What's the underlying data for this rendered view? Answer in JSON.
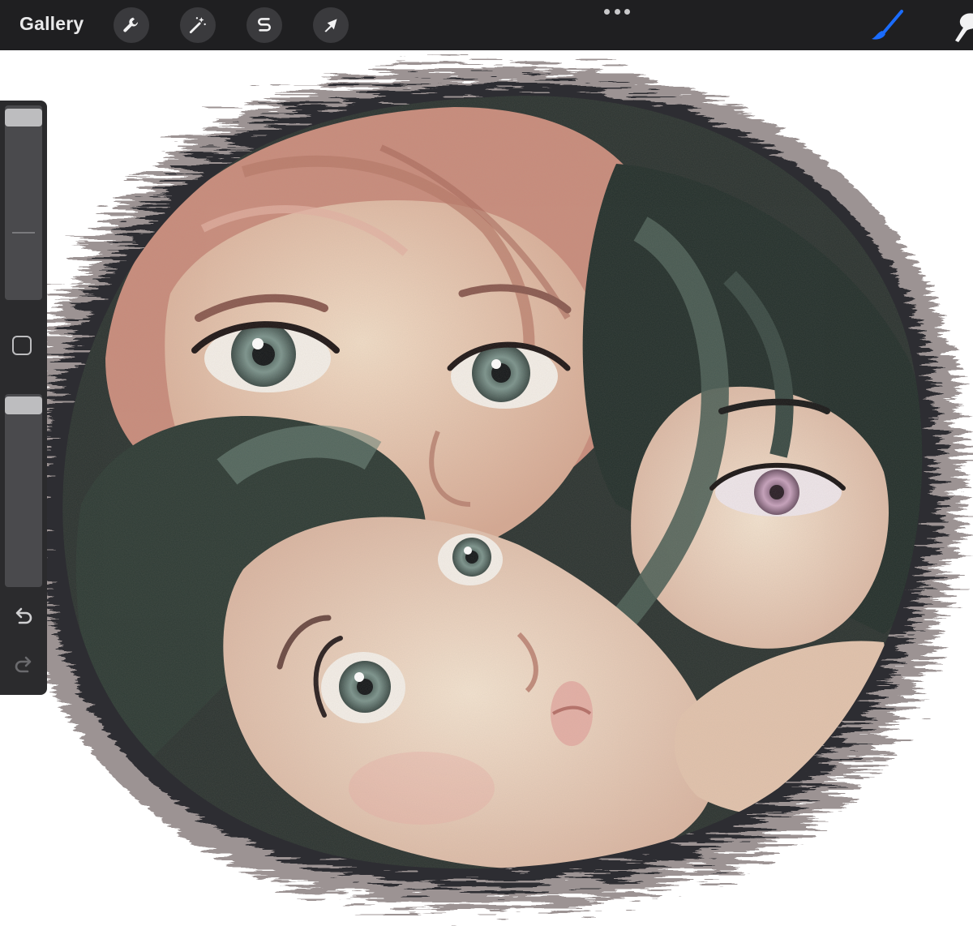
{
  "topbar": {
    "gallery_label": "Gallery",
    "tools": [
      {
        "name": "actions",
        "icon": "wrench-icon"
      },
      {
        "name": "adjustments",
        "icon": "magic-wand-icon"
      },
      {
        "name": "selection",
        "icon": "selection-s-icon"
      },
      {
        "name": "transform",
        "icon": "arrow-cursor-icon"
      }
    ],
    "more_icon": "more-dots-icon",
    "right_tools": [
      {
        "name": "brush",
        "icon": "brush-icon",
        "active": true,
        "color": "#1a6cff"
      },
      {
        "name": "smudge",
        "icon": "smudge-finger-icon",
        "active": false
      }
    ]
  },
  "sidebar": {
    "brush_size_slider": {
      "level": 0.0
    },
    "modify_button_icon": "square-modifier-icon",
    "opacity_slider": {
      "level": 0.0
    },
    "undo_icon": "undo-arrow-icon",
    "redo_icon": "redo-arrow-icon"
  },
  "colors": {
    "toolbar_bg": "#1f1f21",
    "sidebar_bg": "#2b2b2d",
    "accent": "#1a6cff",
    "canvas_bg": "#ffffff"
  }
}
